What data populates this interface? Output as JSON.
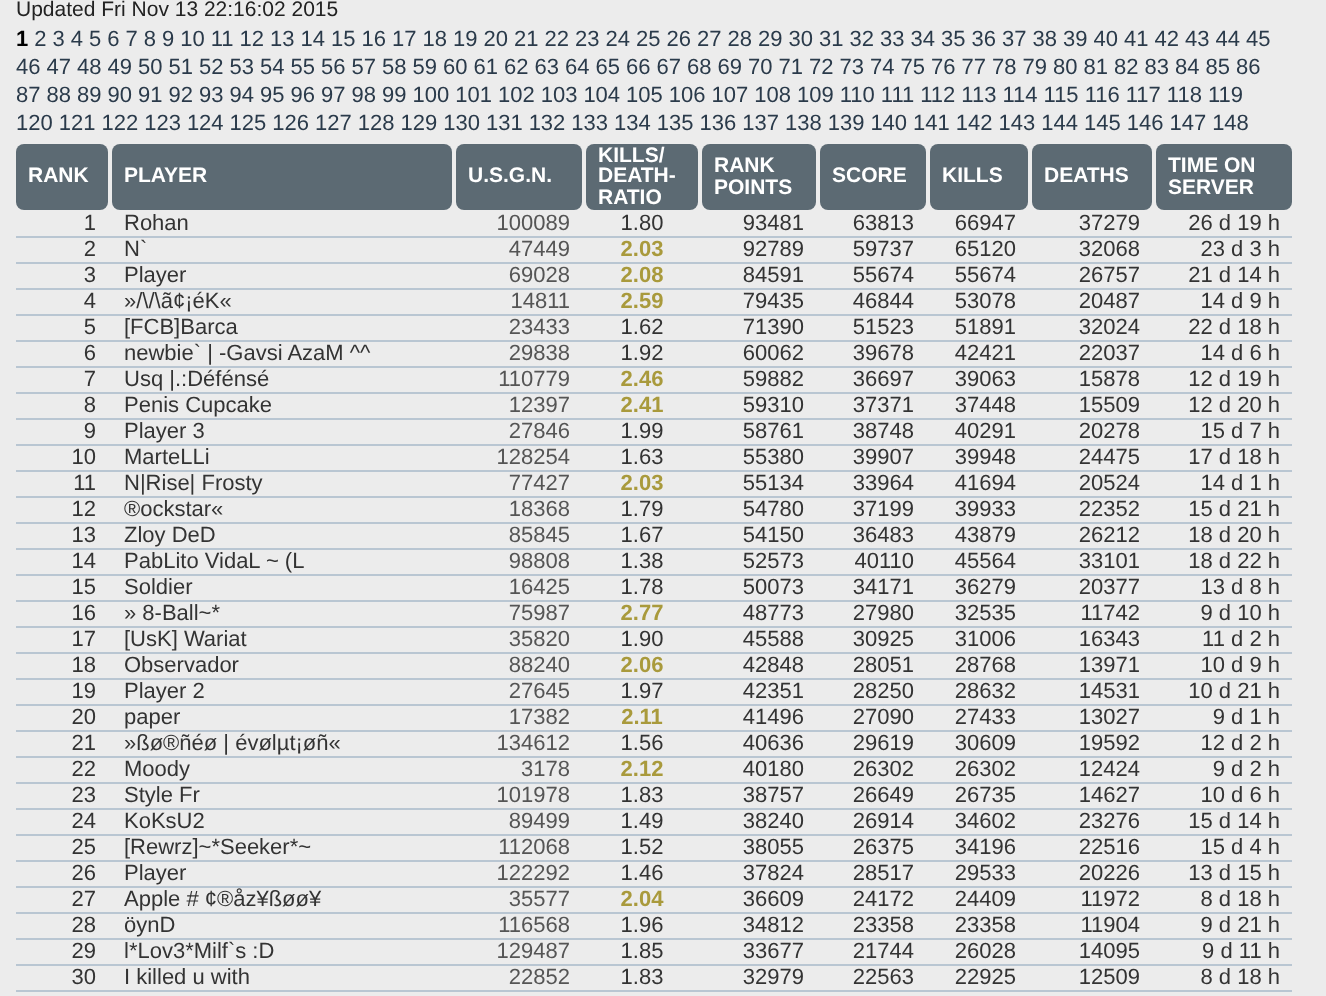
{
  "updated": "Updated Fri Nov 13 22:16:02 2015",
  "page_links": [
    [
      {
        "label": "1",
        "selected": true
      },
      {
        "label": "2",
        "selected": false
      },
      {
        "label": "3",
        "selected": false
      },
      {
        "label": "4",
        "selected": false
      },
      {
        "label": "5",
        "selected": false
      },
      {
        "label": "6",
        "selected": false
      },
      {
        "label": "7",
        "selected": false
      },
      {
        "label": "8",
        "selected": false
      },
      {
        "label": "9",
        "selected": false
      },
      {
        "label": "10",
        "selected": false
      },
      {
        "label": "11",
        "selected": false
      },
      {
        "label": "12",
        "selected": false
      },
      {
        "label": "13",
        "selected": false
      },
      {
        "label": "14",
        "selected": false
      },
      {
        "label": "15",
        "selected": false
      },
      {
        "label": "16",
        "selected": false
      },
      {
        "label": "17",
        "selected": false
      },
      {
        "label": "18",
        "selected": false
      },
      {
        "label": "19",
        "selected": false
      },
      {
        "label": "20",
        "selected": false
      },
      {
        "label": "21",
        "selected": false
      },
      {
        "label": "22",
        "selected": false
      },
      {
        "label": "23",
        "selected": false
      },
      {
        "label": "24",
        "selected": false
      },
      {
        "label": "25",
        "selected": false
      },
      {
        "label": "26",
        "selected": false
      },
      {
        "label": "27",
        "selected": false
      },
      {
        "label": "28",
        "selected": false
      },
      {
        "label": "29",
        "selected": false
      },
      {
        "label": "30",
        "selected": false
      },
      {
        "label": "31",
        "selected": false
      },
      {
        "label": "32",
        "selected": false
      },
      {
        "label": "33",
        "selected": false
      },
      {
        "label": "34",
        "selected": false
      },
      {
        "label": "35",
        "selected": false
      },
      {
        "label": "36",
        "selected": false
      },
      {
        "label": "37",
        "selected": false
      },
      {
        "label": "38",
        "selected": false
      },
      {
        "label": "39",
        "selected": false
      },
      {
        "label": "40",
        "selected": false
      },
      {
        "label": "41",
        "selected": false
      },
      {
        "label": "42",
        "selected": false
      },
      {
        "label": "43",
        "selected": false
      },
      {
        "label": "44",
        "selected": false
      },
      {
        "label": "45",
        "selected": false
      }
    ],
    [
      {
        "label": "46",
        "selected": false
      },
      {
        "label": "47",
        "selected": false
      },
      {
        "label": "48",
        "selected": false
      },
      {
        "label": "49",
        "selected": false
      },
      {
        "label": "50",
        "selected": false
      },
      {
        "label": "51",
        "selected": false
      },
      {
        "label": "52",
        "selected": false
      },
      {
        "label": "53",
        "selected": false
      },
      {
        "label": "54",
        "selected": false
      },
      {
        "label": "55",
        "selected": false
      },
      {
        "label": "56",
        "selected": false
      },
      {
        "label": "57",
        "selected": false
      },
      {
        "label": "58",
        "selected": false
      },
      {
        "label": "59",
        "selected": false
      },
      {
        "label": "60",
        "selected": false
      },
      {
        "label": "61",
        "selected": false
      },
      {
        "label": "62",
        "selected": false
      },
      {
        "label": "63",
        "selected": false
      },
      {
        "label": "64",
        "selected": false
      },
      {
        "label": "65",
        "selected": false
      },
      {
        "label": "66",
        "selected": false
      },
      {
        "label": "67",
        "selected": false
      },
      {
        "label": "68",
        "selected": false
      },
      {
        "label": "69",
        "selected": false
      },
      {
        "label": "70",
        "selected": false
      },
      {
        "label": "71",
        "selected": false
      },
      {
        "label": "72",
        "selected": false
      },
      {
        "label": "73",
        "selected": false
      },
      {
        "label": "74",
        "selected": false
      },
      {
        "label": "75",
        "selected": false
      },
      {
        "label": "76",
        "selected": false
      },
      {
        "label": "77",
        "selected": false
      },
      {
        "label": "78",
        "selected": false
      },
      {
        "label": "79",
        "selected": false
      },
      {
        "label": "80",
        "selected": false
      },
      {
        "label": "81",
        "selected": false
      },
      {
        "label": "82",
        "selected": false
      },
      {
        "label": "83",
        "selected": false
      },
      {
        "label": "84",
        "selected": false
      },
      {
        "label": "85",
        "selected": false
      },
      {
        "label": "86",
        "selected": false
      }
    ],
    [
      {
        "label": "87",
        "selected": false
      },
      {
        "label": "88",
        "selected": false
      },
      {
        "label": "89",
        "selected": false
      },
      {
        "label": "90",
        "selected": false
      },
      {
        "label": "91",
        "selected": false
      },
      {
        "label": "92",
        "selected": false
      },
      {
        "label": "93",
        "selected": false
      },
      {
        "label": "94",
        "selected": false
      },
      {
        "label": "95",
        "selected": false
      },
      {
        "label": "96",
        "selected": false
      },
      {
        "label": "97",
        "selected": false
      },
      {
        "label": "98",
        "selected": false
      },
      {
        "label": "99",
        "selected": false
      },
      {
        "label": "100",
        "selected": false
      },
      {
        "label": "101",
        "selected": false
      },
      {
        "label": "102",
        "selected": false
      },
      {
        "label": "103",
        "selected": false
      },
      {
        "label": "104",
        "selected": false
      },
      {
        "label": "105",
        "selected": false
      },
      {
        "label": "106",
        "selected": false
      },
      {
        "label": "107",
        "selected": false
      },
      {
        "label": "108",
        "selected": false
      },
      {
        "label": "109",
        "selected": false
      },
      {
        "label": "110",
        "selected": false
      },
      {
        "label": "111",
        "selected": false
      },
      {
        "label": "112",
        "selected": false
      },
      {
        "label": "113",
        "selected": false
      },
      {
        "label": "114",
        "selected": false
      },
      {
        "label": "115",
        "selected": false
      },
      {
        "label": "116",
        "selected": false
      },
      {
        "label": "117",
        "selected": false
      },
      {
        "label": "118",
        "selected": false
      },
      {
        "label": "119",
        "selected": false
      }
    ],
    [
      {
        "label": "120",
        "selected": false
      },
      {
        "label": "121",
        "selected": false
      },
      {
        "label": "122",
        "selected": false
      },
      {
        "label": "123",
        "selected": false
      },
      {
        "label": "124",
        "selected": false
      },
      {
        "label": "125",
        "selected": false
      },
      {
        "label": "126",
        "selected": false
      },
      {
        "label": "127",
        "selected": false
      },
      {
        "label": "128",
        "selected": false
      },
      {
        "label": "129",
        "selected": false
      },
      {
        "label": "130",
        "selected": false
      },
      {
        "label": "131",
        "selected": false
      },
      {
        "label": "132",
        "selected": false
      },
      {
        "label": "133",
        "selected": false
      },
      {
        "label": "134",
        "selected": false
      },
      {
        "label": "135",
        "selected": false
      },
      {
        "label": "136",
        "selected": false
      },
      {
        "label": "137",
        "selected": false
      },
      {
        "label": "138",
        "selected": false
      },
      {
        "label": "139",
        "selected": false
      },
      {
        "label": "140",
        "selected": false
      },
      {
        "label": "141",
        "selected": false
      },
      {
        "label": "142",
        "selected": false
      },
      {
        "label": "143",
        "selected": false
      },
      {
        "label": "144",
        "selected": false
      },
      {
        "label": "145",
        "selected": false
      },
      {
        "label": "146",
        "selected": false
      },
      {
        "label": "147",
        "selected": false
      },
      {
        "label": "148",
        "selected": false
      }
    ]
  ],
  "table": {
    "columns": [
      "RANK",
      "PLAYER",
      "U.S.G.N.",
      "KILLS/ DEATH- RATIO",
      "RANK POINTS",
      "SCORE",
      "KILLS",
      "DEATHS",
      "TIME ON SERVER"
    ],
    "rows": [
      {
        "rank": "1",
        "player": "Rohan",
        "usgn": "100089",
        "ratio": "1.80",
        "ratio_highlight": false,
        "rank_points": "93481",
        "score": "63813",
        "kills": "66947",
        "deaths": "37279",
        "time": "26 d 19 h"
      },
      {
        "rank": "2",
        "player": "N`",
        "usgn": "47449",
        "ratio": "2.03",
        "ratio_highlight": true,
        "rank_points": "92789",
        "score": "59737",
        "kills": "65120",
        "deaths": "32068",
        "time": "23 d 3 h"
      },
      {
        "rank": "3",
        "player": "Player",
        "usgn": "69028",
        "ratio": "2.08",
        "ratio_highlight": true,
        "rank_points": "84591",
        "score": "55674",
        "kills": "55674",
        "deaths": "26757",
        "time": "21 d 14 h"
      },
      {
        "rank": "4",
        "player": "»/\\/\\ã¢¡éK«",
        "usgn": "14811",
        "ratio": "2.59",
        "ratio_highlight": true,
        "rank_points": "79435",
        "score": "46844",
        "kills": "53078",
        "deaths": "20487",
        "time": "14 d 9 h"
      },
      {
        "rank": "5",
        "player": "[FCB]Barca",
        "usgn": "23433",
        "ratio": "1.62",
        "ratio_highlight": false,
        "rank_points": "71390",
        "score": "51523",
        "kills": "51891",
        "deaths": "32024",
        "time": "22 d 18 h"
      },
      {
        "rank": "6",
        "player": "newbie` | -Gavsi AzaM ^^",
        "usgn": "29838",
        "ratio": "1.92",
        "ratio_highlight": false,
        "rank_points": "60062",
        "score": "39678",
        "kills": "42421",
        "deaths": "22037",
        "time": "14 d 6 h"
      },
      {
        "rank": "7",
        "player": "Usq |.:Défénsé",
        "usgn": "110779",
        "ratio": "2.46",
        "ratio_highlight": true,
        "rank_points": "59882",
        "score": "36697",
        "kills": "39063",
        "deaths": "15878",
        "time": "12 d 19 h"
      },
      {
        "rank": "8",
        "player": "Penis Cupcake",
        "usgn": "12397",
        "ratio": "2.41",
        "ratio_highlight": true,
        "rank_points": "59310",
        "score": "37371",
        "kills": "37448",
        "deaths": "15509",
        "time": "12 d 20 h"
      },
      {
        "rank": "9",
        "player": "Player 3",
        "usgn": "27846",
        "ratio": "1.99",
        "ratio_highlight": false,
        "rank_points": "58761",
        "score": "38748",
        "kills": "40291",
        "deaths": "20278",
        "time": "15 d 7 h"
      },
      {
        "rank": "10",
        "player": "MarteLLi",
        "usgn": "128254",
        "ratio": "1.63",
        "ratio_highlight": false,
        "rank_points": "55380",
        "score": "39907",
        "kills": "39948",
        "deaths": "24475",
        "time": "17 d 18 h"
      },
      {
        "rank": "11",
        "player": "N|Rise| Frosty",
        "usgn": "77427",
        "ratio": "2.03",
        "ratio_highlight": true,
        "rank_points": "55134",
        "score": "33964",
        "kills": "41694",
        "deaths": "20524",
        "time": "14 d 1 h"
      },
      {
        "rank": "12",
        "player": "®ockstar«",
        "usgn": "18368",
        "ratio": "1.79",
        "ratio_highlight": false,
        "rank_points": "54780",
        "score": "37199",
        "kills": "39933",
        "deaths": "22352",
        "time": "15 d 21 h"
      },
      {
        "rank": "13",
        "player": "Zloy DeD",
        "usgn": "85845",
        "ratio": "1.67",
        "ratio_highlight": false,
        "rank_points": "54150",
        "score": "36483",
        "kills": "43879",
        "deaths": "26212",
        "time": "18 d 20 h"
      },
      {
        "rank": "14",
        "player": "PabLito VidaL ~ (L",
        "usgn": "98808",
        "ratio": "1.38",
        "ratio_highlight": false,
        "rank_points": "52573",
        "score": "40110",
        "kills": "45564",
        "deaths": "33101",
        "time": "18 d 22 h"
      },
      {
        "rank": "15",
        "player": "Soldier",
        "usgn": "16425",
        "ratio": "1.78",
        "ratio_highlight": false,
        "rank_points": "50073",
        "score": "34171",
        "kills": "36279",
        "deaths": "20377",
        "time": "13 d 8 h"
      },
      {
        "rank": "16",
        "player": "» 8-Ball~*",
        "usgn": "75987",
        "ratio": "2.77",
        "ratio_highlight": true,
        "rank_points": "48773",
        "score": "27980",
        "kills": "32535",
        "deaths": "11742",
        "time": "9 d 10 h"
      },
      {
        "rank": "17",
        "player": "[UsK] Wariat",
        "usgn": "35820",
        "ratio": "1.90",
        "ratio_highlight": false,
        "rank_points": "45588",
        "score": "30925",
        "kills": "31006",
        "deaths": "16343",
        "time": "11 d 2 h"
      },
      {
        "rank": "18",
        "player": "Observador",
        "usgn": "88240",
        "ratio": "2.06",
        "ratio_highlight": true,
        "rank_points": "42848",
        "score": "28051",
        "kills": "28768",
        "deaths": "13971",
        "time": "10 d 9 h"
      },
      {
        "rank": "19",
        "player": "Player 2",
        "usgn": "27645",
        "ratio": "1.97",
        "ratio_highlight": false,
        "rank_points": "42351",
        "score": "28250",
        "kills": "28632",
        "deaths": "14531",
        "time": "10 d 21 h"
      },
      {
        "rank": "20",
        "player": "paper",
        "usgn": "17382",
        "ratio": "2.11",
        "ratio_highlight": true,
        "rank_points": "41496",
        "score": "27090",
        "kills": "27433",
        "deaths": "13027",
        "time": "9 d 1 h"
      },
      {
        "rank": "21",
        "player": "»ßø®ñéø | évølµt¡øñ«",
        "usgn": "134612",
        "ratio": "1.56",
        "ratio_highlight": false,
        "rank_points": "40636",
        "score": "29619",
        "kills": "30609",
        "deaths": "19592",
        "time": "12 d 2 h"
      },
      {
        "rank": "22",
        "player": "Moody",
        "usgn": "3178",
        "ratio": "2.12",
        "ratio_highlight": true,
        "rank_points": "40180",
        "score": "26302",
        "kills": "26302",
        "deaths": "12424",
        "time": "9 d 2 h"
      },
      {
        "rank": "23",
        "player": "Style Fr",
        "usgn": "101978",
        "ratio": "1.83",
        "ratio_highlight": false,
        "rank_points": "38757",
        "score": "26649",
        "kills": "26735",
        "deaths": "14627",
        "time": "10 d 6 h"
      },
      {
        "rank": "24",
        "player": "KoKsU2",
        "usgn": "89499",
        "ratio": "1.49",
        "ratio_highlight": false,
        "rank_points": "38240",
        "score": "26914",
        "kills": "34602",
        "deaths": "23276",
        "time": "15 d 14 h"
      },
      {
        "rank": "25",
        "player": "[Rewrz]~*Seeker*~",
        "usgn": "112068",
        "ratio": "1.52",
        "ratio_highlight": false,
        "rank_points": "38055",
        "score": "26375",
        "kills": "34196",
        "deaths": "22516",
        "time": "15 d 4 h"
      },
      {
        "rank": "26",
        "player": "Player",
        "usgn": "122292",
        "ratio": "1.46",
        "ratio_highlight": false,
        "rank_points": "37824",
        "score": "28517",
        "kills": "29533",
        "deaths": "20226",
        "time": "13 d 15 h"
      },
      {
        "rank": "27",
        "player": "Apple # ¢®åz¥ßøø¥",
        "usgn": "35577",
        "ratio": "2.04",
        "ratio_highlight": true,
        "rank_points": "36609",
        "score": "24172",
        "kills": "24409",
        "deaths": "11972",
        "time": "8 d 18 h"
      },
      {
        "rank": "28",
        "player": "öynD",
        "usgn": "116568",
        "ratio": "1.96",
        "ratio_highlight": false,
        "rank_points": "34812",
        "score": "23358",
        "kills": "23358",
        "deaths": "11904",
        "time": "9 d 21 h"
      },
      {
        "rank": "29",
        "player": "l*Lov3*Milf`s :D",
        "usgn": "129487",
        "ratio": "1.85",
        "ratio_highlight": false,
        "rank_points": "33677",
        "score": "21744",
        "kills": "26028",
        "deaths": "14095",
        "time": "9 d 11 h"
      },
      {
        "rank": "30",
        "player": "I killed u with",
        "usgn": "22852",
        "ratio": "1.83",
        "ratio_highlight": false,
        "rank_points": "32979",
        "score": "22563",
        "kills": "22925",
        "deaths": "12509",
        "time": "8 d 18 h"
      }
    ]
  }
}
